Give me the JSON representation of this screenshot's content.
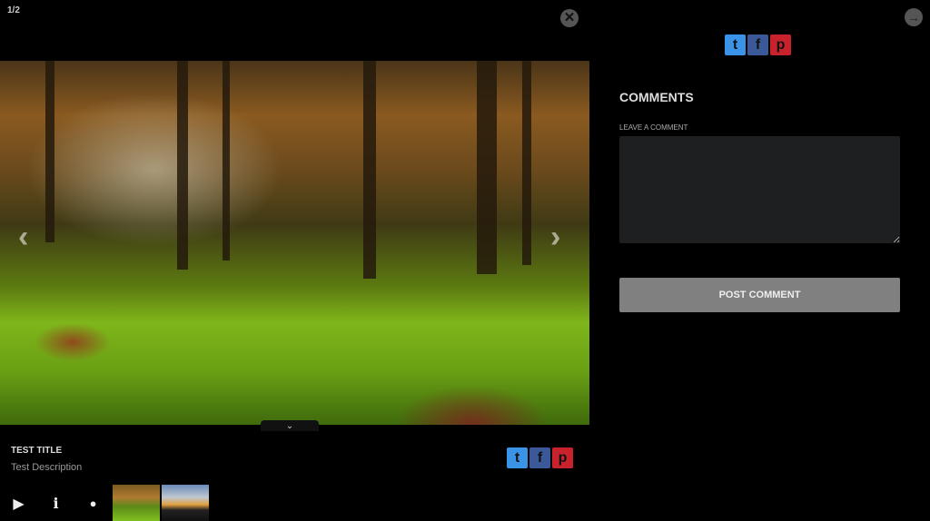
{
  "viewer": {
    "counter": "1/2",
    "close_icon": "close-icon",
    "next_icon": "arrow-right-icon",
    "prev_arrow": "‹",
    "next_arrow": "›",
    "expand_icon": "⌄"
  },
  "image": {
    "title": "TEST TITLE",
    "description": "Test Description"
  },
  "social": {
    "twitter": "t",
    "facebook": "f",
    "pinterest": "p"
  },
  "controls": {
    "play": "▶",
    "info": "i",
    "comment": "💬"
  },
  "thumbnails": [
    "forest-photo",
    "sunset-photo"
  ],
  "comments": {
    "heading": "COMMENTS",
    "leave_label": "LEAVE A COMMENT",
    "textarea_value": "",
    "post_button": "POST COMMENT"
  }
}
